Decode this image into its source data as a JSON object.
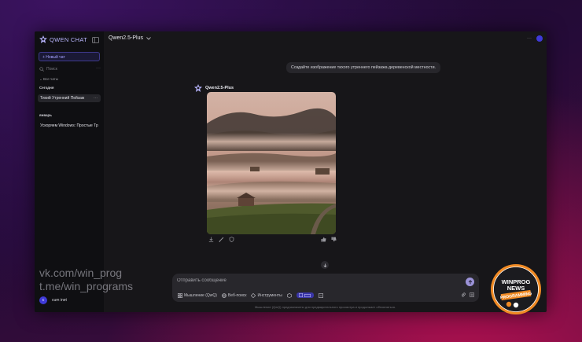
{
  "app": {
    "name": "QWEN CHAT"
  },
  "sidebar": {
    "new_chat_label": "+ Новый чат",
    "search_label": "Поиск",
    "more_glyph": "···",
    "all_chats_label": "Все чаты",
    "sections": [
      {
        "title": "Сегодня",
        "items": [
          {
            "label": "Тихий Утренний Пейзаж",
            "active": true
          }
        ]
      },
      {
        "title": "январь",
        "items": [
          {
            "label": "Ускоряем Windows: Простые Тр",
            "active": false
          }
        ]
      }
    ],
    "user": {
      "initial": "c",
      "name": "cum inet"
    }
  },
  "header": {
    "model": "Qwen2.5-Plus",
    "more_glyph": "···"
  },
  "conversation": {
    "user_message": "Создайте изображение тихого утреннего пейзажа деревенской местности.",
    "assistant_name": "Qwen2.5-Plus",
    "image_subject": "misty rural morning landscape"
  },
  "composer": {
    "placeholder": "Отправить сообщение",
    "tools": {
      "thinking": "Мышление (QwQ)",
      "web_search": "Веб-поиск",
      "instruments": "Инструменты"
    }
  },
  "disclaimer": "Мышление (QwQ) предназначено для предварительного просмотра и продолжает обновляться.",
  "overlay": {
    "watermark_line1": "vk.com/win_prog",
    "watermark_line2": "t.me/win_programs",
    "badge": {
      "line1": "WINPROG",
      "line2": "NEWS",
      "line3": "PROGRAMMING"
    }
  },
  "colors": {
    "accent": "#9c93d8",
    "logo": "#b9b6ff",
    "brand_chip": "#3a36a8",
    "badge_orange": "#f08a24"
  }
}
